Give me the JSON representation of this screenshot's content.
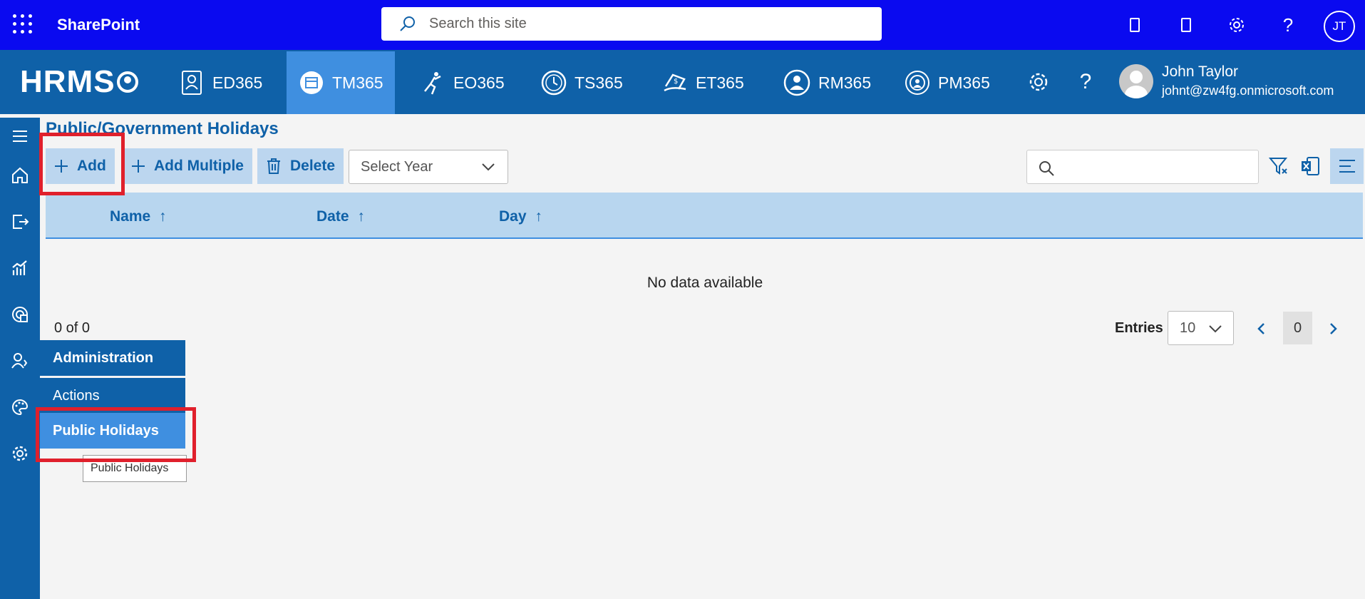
{
  "suitebar": {
    "title": "SharePoint",
    "search_placeholder": "Search this site",
    "user_initials": "JT"
  },
  "appbar": {
    "logo": "HRMS",
    "modules": [
      {
        "label": "ED365",
        "icon": "employee-directory-icon"
      },
      {
        "label": "TM365",
        "icon": "calendar-icon",
        "active": true
      },
      {
        "label": "EO365",
        "icon": "onboarding-icon"
      },
      {
        "label": "TS365",
        "icon": "clock-icon"
      },
      {
        "label": "ET365",
        "icon": "expense-icon"
      },
      {
        "label": "RM365",
        "icon": "recruitment-icon"
      },
      {
        "label": "PM365",
        "icon": "performance-icon"
      }
    ],
    "user": {
      "name": "John Taylor",
      "email": "johnt@zw4fg.onmicrosoft.com"
    }
  },
  "page": {
    "title": "Public/Government Holidays"
  },
  "toolbar": {
    "add_label": "Add",
    "add_multiple_label": "Add Multiple",
    "delete_label": "Delete",
    "year_placeholder": "Select Year"
  },
  "table": {
    "columns": [
      {
        "label": "Name"
      },
      {
        "label": "Date"
      },
      {
        "label": "Day"
      }
    ],
    "sort_indicator": "↑",
    "empty_text": "No data available"
  },
  "pagination": {
    "count_text": "0 of 0",
    "entries_label": "Entries",
    "entries_value": "10",
    "current_page": "0"
  },
  "flyout": {
    "items": [
      {
        "label": "Administration"
      },
      {
        "label": "Actions"
      },
      {
        "label": "Public Holidays"
      }
    ],
    "tooltip": "Public Holidays"
  },
  "colors": {
    "suitebar": "#0a0af0",
    "appbar": "#0f61a8",
    "active": "#3f8fe0",
    "highlight": "#e0202c"
  }
}
